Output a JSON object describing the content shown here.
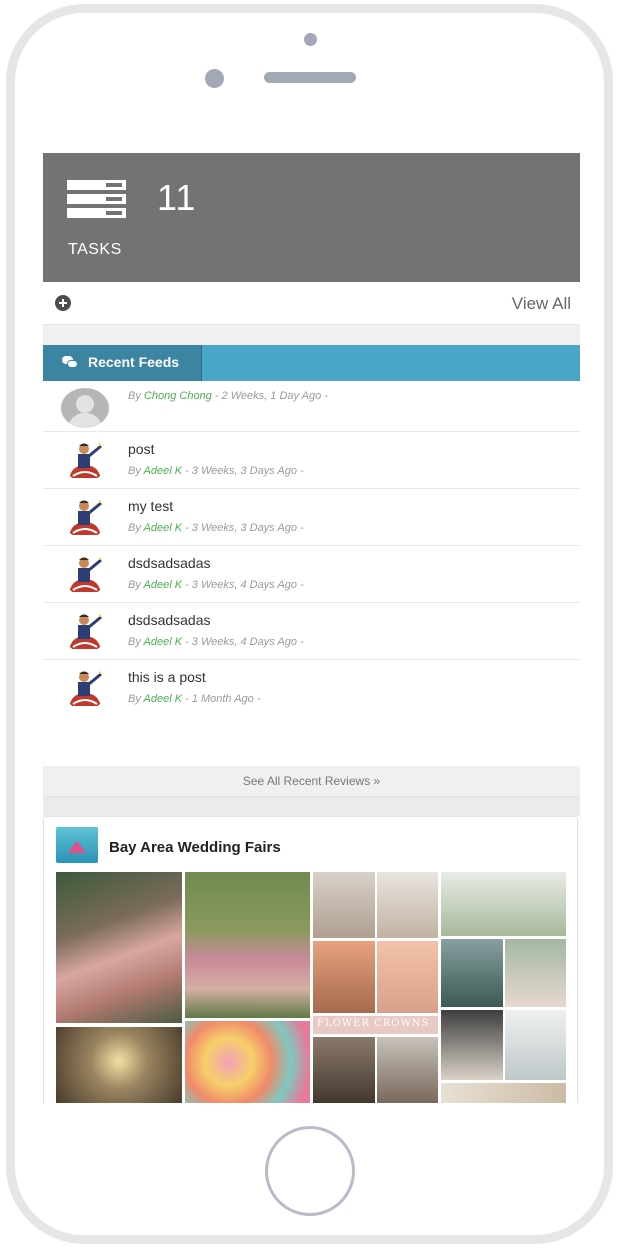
{
  "stats": {
    "count": "11",
    "label": "TASKS",
    "view_all": "View All"
  },
  "feeds": {
    "title": "Recent Feeds",
    "items": [
      {
        "text": "",
        "by": "By ",
        "author": "Chong Chong",
        "time": " - 2 Weeks, 1 Day Ago -",
        "avatar": "default-avatar"
      },
      {
        "text": "post",
        "by": "By ",
        "author": "Adeel K",
        "time": " - 3 Weeks, 3 Days Ago -",
        "avatar": "user-avatar"
      },
      {
        "text": "my test",
        "by": "By ",
        "author": "Adeel K",
        "time": " - 3 Weeks, 3 Days Ago -",
        "avatar": "user-avatar"
      },
      {
        "text": "dsdsadsadas",
        "by": "By ",
        "author": "Adeel K",
        "time": " - 3 Weeks, 4 Days Ago -",
        "avatar": "user-avatar"
      },
      {
        "text": "dsdsadsadas",
        "by": "By ",
        "author": "Adeel K",
        "time": " - 3 Weeks, 4 Days Ago -",
        "avatar": "user-avatar"
      },
      {
        "text": "this is a post",
        "by": "By ",
        "author": "Adeel K",
        "time": " - 1 Month Ago -",
        "avatar": "user-avatar"
      }
    ]
  },
  "reviews": {
    "see_all": "See All Recent Reviews »"
  },
  "vendor": {
    "name": "Bay Area Wedding Fairs",
    "banner_text": "FLOWER CROWNS"
  },
  "colors": {
    "tile_bg": "#737373",
    "feeds_header": "#4aa6c9",
    "feeds_tab": "#3b84a2",
    "author_link": "#4caf50"
  },
  "icons": {
    "tasks": "tasks-list-icon",
    "add": "plus-circle-icon",
    "feeds": "comments-icon"
  }
}
